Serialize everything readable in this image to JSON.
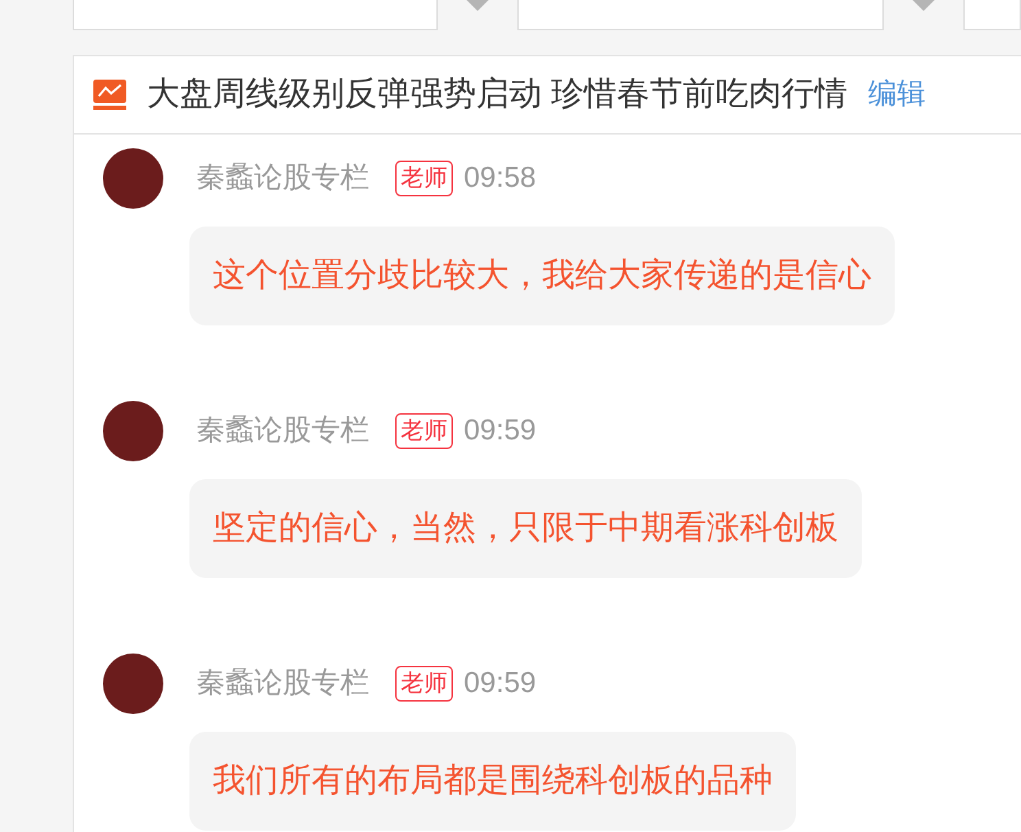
{
  "topic": {
    "title": "大盘周线级别反弹强势启动 珍惜春节前吃肉行情",
    "edit_link": "编辑"
  },
  "messages": [
    {
      "author": "秦蠡论股专栏",
      "role_badge": "老师",
      "time": "09:58",
      "text": "这个位置分歧比较大，我给大家传递的是信心"
    },
    {
      "author": "秦蠡论股专栏",
      "role_badge": "老师",
      "time": "09:59",
      "text": "坚定的信心，当然，只限于中期看涨科创板"
    },
    {
      "author": "秦蠡论股专栏",
      "role_badge": "老师",
      "time": "09:59",
      "text": "我们所有的布局都是围绕科创板的品种"
    }
  ]
}
